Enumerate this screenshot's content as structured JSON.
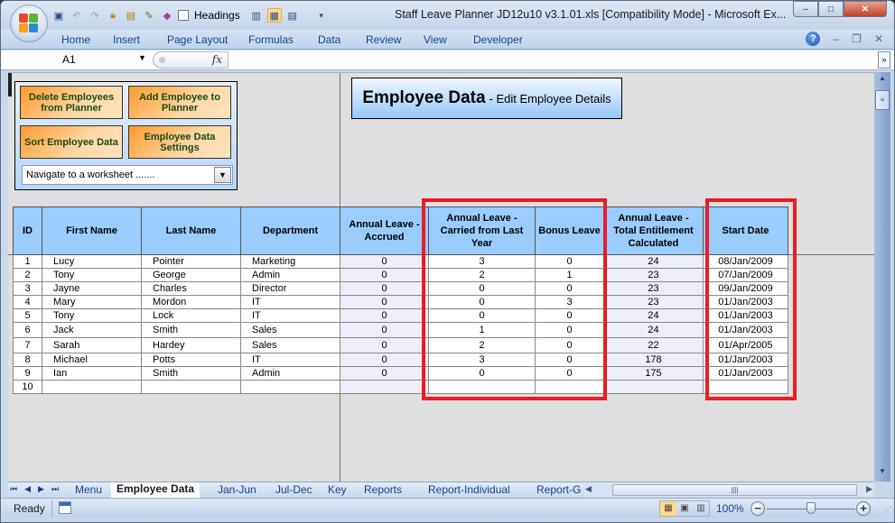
{
  "window": {
    "title": "Staff Leave Planner JD12u10 v3.1.01.xls  [Compatibility Mode] - Microsoft Ex...",
    "controls": {
      "minimize": "–",
      "maximize": "□",
      "close": "✕"
    }
  },
  "quick_access": {
    "headings_label": "Headings",
    "icons": [
      "save-icon",
      "undo-icon",
      "redo-icon",
      "protect-sheet-icon",
      "protect-workbook-icon",
      "design-mode-icon",
      "properties-icon",
      "headings-checkbox",
      "page-layout-view-icon",
      "normal-view-icon",
      "page-break-preview-icon",
      "customize-qat-icon"
    ]
  },
  "ribbon": {
    "tabs": [
      "Home",
      "Insert",
      "Page Layout",
      "Formulas",
      "Data",
      "Review",
      "View",
      "Developer"
    ],
    "help": "?",
    "mdi_min": "–",
    "mdi_restore": "❐",
    "mdi_close": "✕"
  },
  "formula_bar": {
    "name_box": "A1",
    "fx": "fx",
    "formula": "",
    "expand": "»"
  },
  "control_panel": {
    "buttons": [
      "Delete Employees from Planner",
      "Add Employee to Planner",
      "Sort  Employee Data",
      "Employee Data Settings"
    ],
    "navigate_select": "Navigate to a worksheet ......."
  },
  "banner": {
    "title": "Employee Data",
    "subtitle": "- Edit Employee Details"
  },
  "table": {
    "headers": [
      "ID",
      "First Name",
      "Last Name",
      "Department",
      "Annual Leave - Accrued",
      "Annual Leave - Carried from Last Year",
      "Bonus Leave",
      "Annual Leave - Total Entitlement Calculated",
      "Start Date"
    ],
    "rows": [
      [
        "1",
        "Lucy",
        "Pointer",
        "Marketing",
        "0",
        "3",
        "0",
        "24",
        "08/Jan/2009"
      ],
      [
        "2",
        "Tony",
        "George",
        "Admin",
        "0",
        "2",
        "1",
        "23",
        "07/Jan/2009"
      ],
      [
        "3",
        "Jayne",
        "Charles",
        "Director",
        "0",
        "0",
        "0",
        "23",
        "09/Jan/2009"
      ],
      [
        "4",
        "Mary",
        "Mordon",
        "IT",
        "0",
        "0",
        "3",
        "23",
        "01/Jan/2003"
      ],
      [
        "5",
        "Tony",
        "Lock",
        "IT",
        "0",
        "0",
        "0",
        "24",
        "01/Jan/2003"
      ],
      [
        "6",
        "Jack",
        "Smith",
        "Sales",
        "0",
        "1",
        "0",
        "24",
        "01/Jan/2003"
      ],
      [
        "7",
        "Sarah",
        "Hardey",
        "Sales",
        "0",
        "2",
        "0",
        "22",
        "01/Apr/2005"
      ],
      [
        "8",
        "Michael",
        "Potts",
        "IT",
        "0",
        "3",
        "0",
        "178",
        "01/Jan/2003"
      ],
      [
        "9",
        "Ian",
        "Smith",
        "Admin",
        "0",
        "0",
        "0",
        "175",
        "01/Jan/2003"
      ],
      [
        "10",
        "",
        "",
        "",
        "",
        "",
        "",
        "",
        ""
      ]
    ],
    "highlight_color": "#ea1c24",
    "header_color": "#99ccff"
  },
  "sheet_tabs": {
    "tabs": [
      "Menu",
      "Employee Data",
      "Jan-Jun",
      "Jul-Dec",
      "Key",
      "Reports",
      "Report-Individual",
      "Report-G"
    ],
    "active": "Employee Data",
    "nav": [
      "⏮",
      "◀",
      "▶",
      "⏭"
    ]
  },
  "statusbar": {
    "status": "Ready",
    "zoom": "100%",
    "zoom_minus": "−",
    "zoom_plus": "+",
    "zoom_fraction": 0.5
  }
}
